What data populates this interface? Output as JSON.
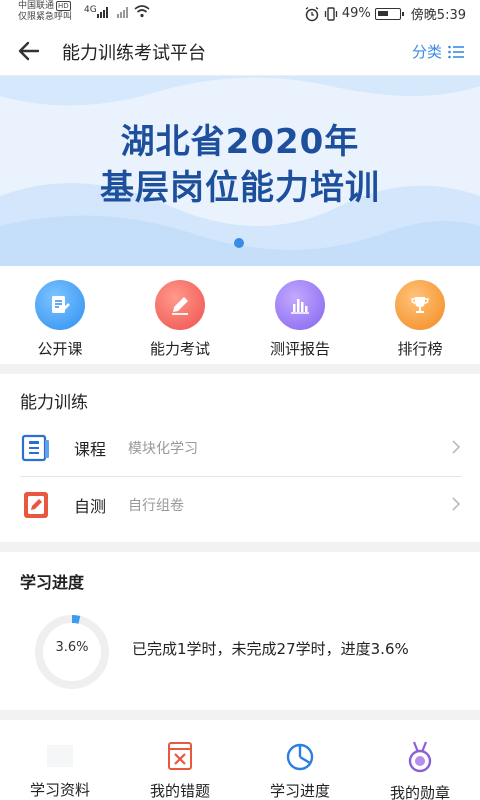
{
  "status_bar": {
    "carrier_line1": "中国联通",
    "carrier_badge": "HD",
    "carrier_line2": "仅限紧急呼叫",
    "network": "4G",
    "battery": "49%",
    "time": "傍晚5:39"
  },
  "app_bar": {
    "title": "能力训练考试平台",
    "category_label": "分类"
  },
  "banner": {
    "line1": "湖北省2020年",
    "line2": "基层岗位能力培训"
  },
  "quick_menu": [
    {
      "label": "公开课",
      "icon": "document-edit-icon",
      "color": "#3b9cf0"
    },
    {
      "label": "能力考试",
      "icon": "pen-icon",
      "color": "#f0605a"
    },
    {
      "label": "测评报告",
      "icon": "bar-chart-icon",
      "color": "#8b6cf0"
    },
    {
      "label": "排行榜",
      "icon": "trophy-icon",
      "color": "#f5972e"
    }
  ],
  "ability": {
    "title": "能力训练",
    "items": [
      {
        "name": "课程",
        "desc": "模块化学习",
        "icon": "course-book-icon"
      },
      {
        "name": "自测",
        "desc": "自行组卷",
        "icon": "self-test-icon"
      }
    ]
  },
  "progress": {
    "title": "学习进度",
    "percent_label": "3.6%",
    "percent_value": 3.6,
    "summary": "已完成1学时，未完成27学时，进度3.6%"
  },
  "bottom_nav": [
    {
      "label": "学习资料",
      "icon": "study-materials-icon"
    },
    {
      "label": "我的错题",
      "icon": "wrong-questions-icon"
    },
    {
      "label": "学习进度",
      "icon": "pie-progress-icon"
    },
    {
      "label": "我的勋章",
      "icon": "medal-icon"
    }
  ],
  "colors": {
    "accent": "#3a8be6",
    "banner_text": "#1d4f9c",
    "separator": "#f2f2f2"
  }
}
